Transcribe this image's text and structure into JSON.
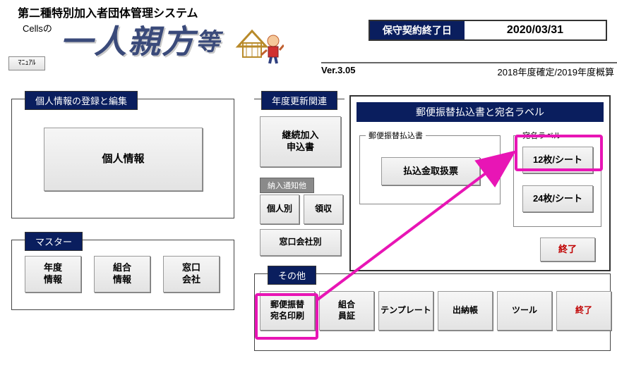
{
  "header": {
    "system_title": "第二種特別加入者団体管理システム",
    "cells_of": "Cellsの",
    "big_title_main": "一人親方",
    "big_title_suffix": "等",
    "manual_btn": "ﾏﾆｭｱﾙ",
    "contract_label": "保守契約終了日",
    "contract_date": "2020/03/31",
    "version": "Ver.3.05",
    "fiscal_year": "2018年度確定/2019年度概算"
  },
  "groups": {
    "personal": {
      "title": "個人情報の登録と編集",
      "btn": "個人情報"
    },
    "master": {
      "title": "マスター",
      "year": "年度\n情報",
      "union": "組合\n情報",
      "window": "窓口\n会社"
    },
    "renewal": {
      "title": "年度更新関連",
      "renew": "継続加入\n申込書",
      "sub_nounyuu": "納入通知他",
      "kojin": "個人別",
      "ryoushuu": "領収",
      "madoguchi": "窓口会社別"
    },
    "other": {
      "title": "その他",
      "items": [
        "郵便振替\n宛名印刷",
        "組合\n員証",
        "テンプレート",
        "出納帳",
        "ツール",
        "終了"
      ]
    }
  },
  "dialog": {
    "title": "郵便振替払込書と宛名ラベル",
    "fs_yubin": "郵便振替払込書",
    "btn_harai": "払込金取扱票",
    "fs_atena": "宛名ラベル",
    "btn_12": "12枚/シート",
    "btn_24": "24枚/シート",
    "btn_end": "終了"
  }
}
